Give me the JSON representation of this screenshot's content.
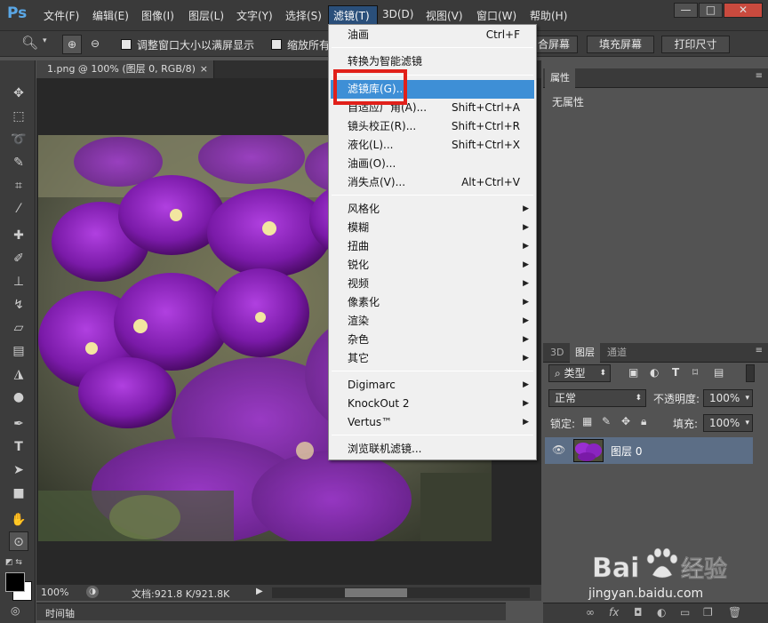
{
  "app": {
    "logo": "Ps"
  },
  "menubar": {
    "items": [
      "文件(F)",
      "编辑(E)",
      "图像(I)",
      "图层(L)",
      "文字(Y)",
      "选择(S)",
      "滤镜(T)",
      "3D(D)",
      "视图(V)",
      "窗口(W)",
      "帮助(H)"
    ]
  },
  "window_controls": {
    "minimize": "—",
    "restore": "□",
    "close": "✕"
  },
  "options": {
    "fit_label": "调整窗口大小以满屏显示",
    "zoom_all_label": "缩放所有",
    "fit_screen": "合屏幕",
    "fill_screen": "填充屏幕",
    "print_size": "打印尺寸"
  },
  "document": {
    "tab_title": "1.png @ 100% (图层 0, RGB/8)",
    "tab_close": "×",
    "zoom": "100%",
    "doc_size": "文档:921.8 K/921.8K"
  },
  "timeline": {
    "label": "时间轴"
  },
  "properties_panel": {
    "tab": "属性",
    "empty_text": "无属性"
  },
  "layers_panel": {
    "tabs": [
      "3D",
      "图层",
      "通道"
    ],
    "filter_kind": "类型",
    "blend_mode": "正常",
    "opacity_label": "不透明度:",
    "opacity_value": "100%",
    "lock_label": "锁定:",
    "fill_label": "填充:",
    "fill_value": "100%",
    "layers": [
      {
        "name": "图层 0"
      }
    ]
  },
  "filter_menu": {
    "items": [
      {
        "label": "油画",
        "shortcut": "Ctrl+F"
      },
      {
        "label": "转换为智能滤镜",
        "shortcut": ""
      },
      {
        "label": "滤镜库(G)...",
        "shortcut": "",
        "highlighted": true
      },
      {
        "label": "自适应广角(A)...",
        "shortcut": "Shift+Ctrl+A"
      },
      {
        "label": "镜头校正(R)...",
        "shortcut": "Shift+Ctrl+R"
      },
      {
        "label": "液化(L)...",
        "shortcut": "Shift+Ctrl+X"
      },
      {
        "label": "油画(O)...",
        "shortcut": ""
      },
      {
        "label": "消失点(V)...",
        "shortcut": "Alt+Ctrl+V"
      },
      {
        "label": "风格化",
        "submenu": true
      },
      {
        "label": "模糊",
        "submenu": true
      },
      {
        "label": "扭曲",
        "submenu": true
      },
      {
        "label": "锐化",
        "submenu": true
      },
      {
        "label": "视频",
        "submenu": true
      },
      {
        "label": "像素化",
        "submenu": true
      },
      {
        "label": "渲染",
        "submenu": true
      },
      {
        "label": "杂色",
        "submenu": true
      },
      {
        "label": "其它",
        "submenu": true
      },
      {
        "label": "Digimarc",
        "submenu": true
      },
      {
        "label": "KnockOut 2",
        "submenu": true
      },
      {
        "label": "Vertus™",
        "submenu": true
      },
      {
        "label": "浏览联机滤镜...",
        "shortcut": ""
      }
    ]
  },
  "watermark": {
    "brand": "Baidu",
    "brand_cn": "经验",
    "url": "jingyan.baidu.com"
  },
  "colors": {
    "accent": "#3e8fd6",
    "highlight_box": "#e1201a",
    "ps_logo": "#5aa7e6"
  }
}
